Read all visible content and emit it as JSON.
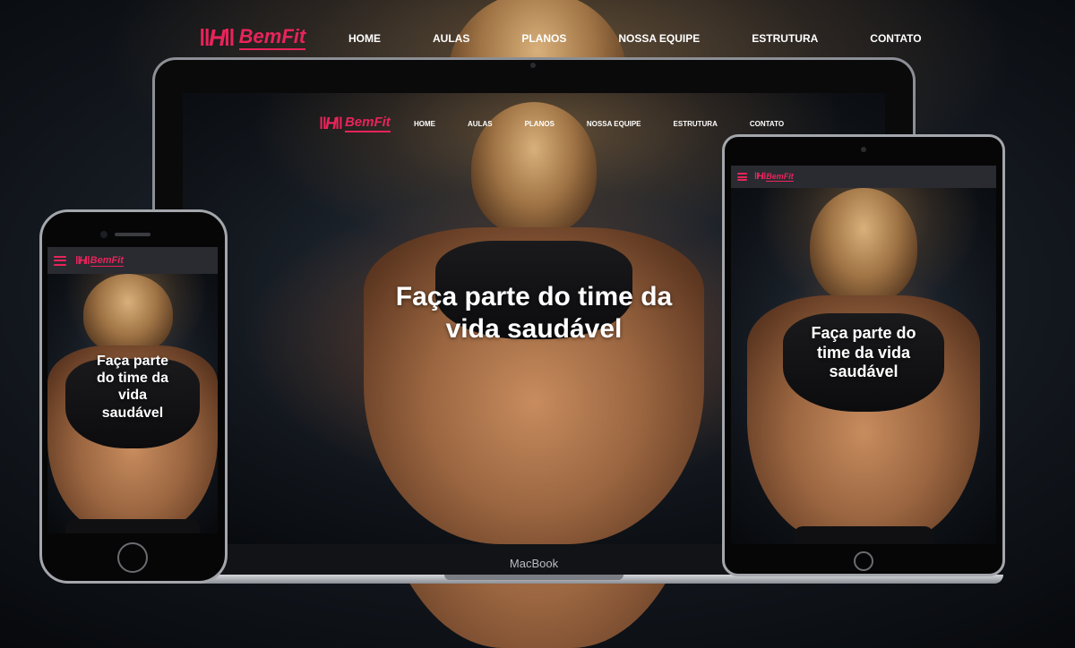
{
  "brand": {
    "name": "BemFit",
    "mark": "H",
    "accent": "#e8245a"
  },
  "nav": {
    "items": [
      {
        "id": "home",
        "label": "HOME"
      },
      {
        "id": "aulas",
        "label": "AULAS"
      },
      {
        "id": "planos",
        "label": "PLANOS"
      },
      {
        "id": "equipe",
        "label": "NOSSA EQUIPE"
      },
      {
        "id": "estrutura",
        "label": "ESTRUTURA"
      },
      {
        "id": "contato",
        "label": "CONTATO"
      }
    ]
  },
  "hero": {
    "title": "Faça parte do time da vida saudável"
  },
  "devices": {
    "laptop_brand": "MacBook"
  },
  "icons": {
    "menu": "hamburger-menu-icon",
    "logo": "barbell-logo-icon"
  }
}
